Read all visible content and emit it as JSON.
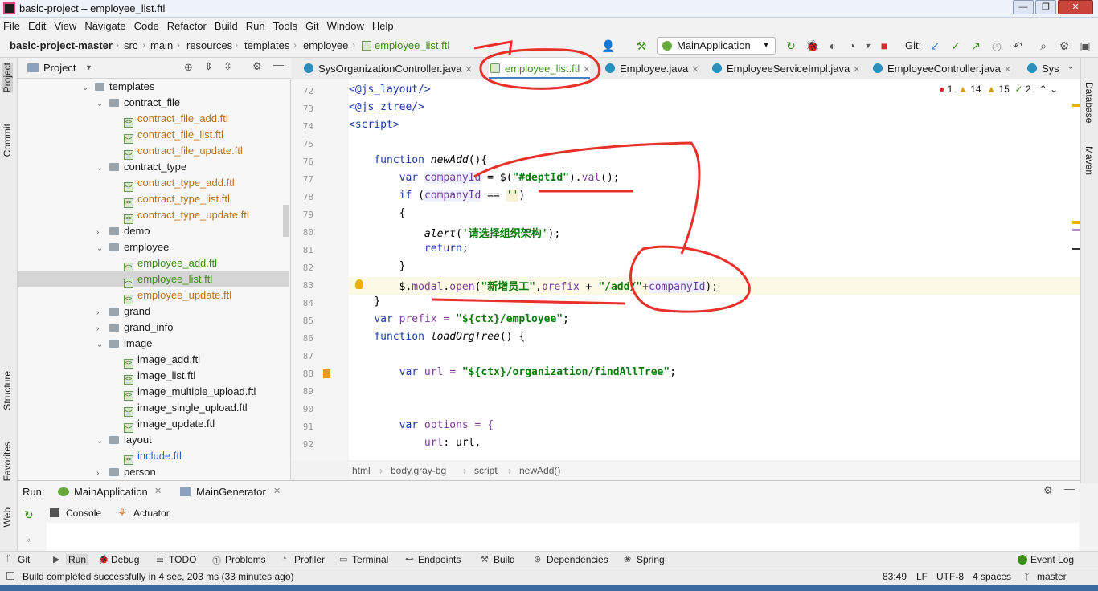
{
  "window": {
    "title": "basic-project – employee_list.ftl",
    "min": "—",
    "max": "❐",
    "close": "✕"
  },
  "menu": [
    "File",
    "Edit",
    "View",
    "Navigate",
    "Code",
    "Refactor",
    "Build",
    "Run",
    "Tools",
    "Git",
    "Window",
    "Help"
  ],
  "breadcrumbs": [
    "basic-project-master",
    "src",
    "main",
    "resources",
    "templates",
    "employee",
    "employee_list.ftl"
  ],
  "toolbar": {
    "run_config": "MainApplication",
    "git_label": "Git:"
  },
  "left_tabs": [
    "Project",
    "Commit",
    "Structure",
    "Favorites",
    "Web"
  ],
  "right_tabs": [
    "Database",
    "Maven"
  ],
  "project_panel": {
    "title": "Project",
    "tree": [
      {
        "label": "templates",
        "type": "folder",
        "open": true
      },
      {
        "label": "contract_file",
        "type": "folder",
        "open": true
      },
      {
        "label": "contract_file_add.ftl",
        "type": "ftl",
        "color": "orange"
      },
      {
        "label": "contract_file_list.ftl",
        "type": "ftl",
        "color": "orange"
      },
      {
        "label": "contract_file_update.ftl",
        "type": "ftl",
        "color": "orange"
      },
      {
        "label": "contract_type",
        "type": "folder",
        "open": true
      },
      {
        "label": "contract_type_add.ftl",
        "type": "ftl",
        "color": "orange"
      },
      {
        "label": "contract_type_list.ftl",
        "type": "ftl",
        "color": "orange"
      },
      {
        "label": "contract_type_update.ftl",
        "type": "ftl",
        "color": "orange"
      },
      {
        "label": "demo",
        "type": "folder",
        "open": false
      },
      {
        "label": "employee",
        "type": "folder",
        "open": true
      },
      {
        "label": "employee_add.ftl",
        "type": "ftl",
        "color": "green"
      },
      {
        "label": "employee_list.ftl",
        "type": "ftl",
        "color": "green",
        "selected": true
      },
      {
        "label": "employee_update.ftl",
        "type": "ftl",
        "color": "orange"
      },
      {
        "label": "grand",
        "type": "folder",
        "open": false
      },
      {
        "label": "grand_info",
        "type": "folder",
        "open": false
      },
      {
        "label": "image",
        "type": "folder",
        "open": true
      },
      {
        "label": "image_add.ftl",
        "type": "ftl",
        "color": "default"
      },
      {
        "label": "image_list.ftl",
        "type": "ftl",
        "color": "default"
      },
      {
        "label": "image_multiple_upload.ftl",
        "type": "ftl",
        "color": "default"
      },
      {
        "label": "image_single_upload.ftl",
        "type": "ftl",
        "color": "default"
      },
      {
        "label": "image_update.ftl",
        "type": "ftl",
        "color": "default"
      },
      {
        "label": "layout",
        "type": "folder",
        "open": true
      },
      {
        "label": "include.ftl",
        "type": "ftl",
        "color": "blue"
      },
      {
        "label": "person",
        "type": "folder",
        "open": false
      }
    ]
  },
  "editor_tabs": [
    {
      "label": "SysOrganizationController.java"
    },
    {
      "label": "employee_list.ftl",
      "active": true
    },
    {
      "label": "Employee.java"
    },
    {
      "label": "EmployeeServiceImpl.java"
    },
    {
      "label": "EmployeeController.java"
    },
    {
      "label": "Sys"
    }
  ],
  "inspections": {
    "errors": "1",
    "warnings": "14",
    "weak": "15",
    "typos": "2"
  },
  "code": {
    "line_numbers": [
      "72",
      "73",
      "74",
      "75",
      "76",
      "77",
      "78",
      "79",
      "80",
      "81",
      "82",
      "83",
      "84",
      "85",
      "86",
      "87",
      "88",
      "89",
      "90",
      "91",
      "92"
    ],
    "l72": "<@js_layout/>",
    "l73": "<@js_ztree/>",
    "l74": "<script>",
    "l76_kw": "function",
    "l76_fn": "newAdd",
    "l76_rest": "(){",
    "l77_kw": "var",
    "l77_var": "companyId",
    "l77_a": " = $(",
    "l77_str": "\"#deptId\"",
    "l77_b": ").",
    "l77_m": "val",
    "l77_c": "();",
    "l78_kw": "if",
    "l78_a": " (",
    "l78_var": "companyId",
    "l78_b": " == ",
    "l78_str": "''",
    "l78_c": ")",
    "l79": "{",
    "l80_fn": "alert",
    "l80_a": "(",
    "l80_str": "'请选择组织架构'",
    "l80_b": ");",
    "l81_kw": "return",
    "l81_a": ";",
    "l82": "}",
    "l83_a": "$.",
    "l83_m1": "modal",
    "l83_dot": ".",
    "l83_m2": "open",
    "l83_b": "(",
    "l83_str": "\"新增员工\"",
    "l83_c": ",",
    "l83_var": "prefix",
    "l83_d": " + ",
    "l83_str2": "\"/add/\"",
    "l83_e": "+",
    "l83_var2": "companyId",
    "l83_f": ");",
    "l84": "}",
    "l85_kw": "var",
    "l85_var": " prefix = ",
    "l85_str": "\"${ctx}/employee\"",
    "l85_a": ";",
    "l86_kw": "function",
    "l86_fn": "loadOrgTree",
    "l86_rest": "() {",
    "l88_kw": "var",
    "l88_var": " url = ",
    "l88_str": "\"${ctx}/organization/findAllTree\"",
    "l88_a": ";",
    "l91_kw": "var",
    "l91_rest": " options = {",
    "l92_key": "url",
    "l92_rest": ": url,"
  },
  "code_breadcrumb": [
    "html",
    "body.gray-bg",
    "script",
    "newAdd()"
  ],
  "run_panel": {
    "label": "Run:",
    "tabs": [
      "MainApplication",
      "MainGenerator"
    ],
    "subtabs": [
      "Console",
      "Actuator"
    ]
  },
  "bottom_tools": [
    "Git",
    "Run",
    "Debug",
    "TODO",
    "Problems",
    "Profiler",
    "Terminal",
    "Endpoints",
    "Build",
    "Dependencies",
    "Spring"
  ],
  "event_log": "Event Log",
  "status": {
    "message": "Build completed successfully in 4 sec, 203 ms (33 minutes ago)",
    "position": "83:49",
    "line_sep": "LF",
    "encoding": "UTF-8",
    "indent": "4 spaces",
    "branch": "master"
  },
  "colors": {
    "accent": "#4083c9",
    "annotation": "#e8312a",
    "current_line": "#fcfae6"
  }
}
